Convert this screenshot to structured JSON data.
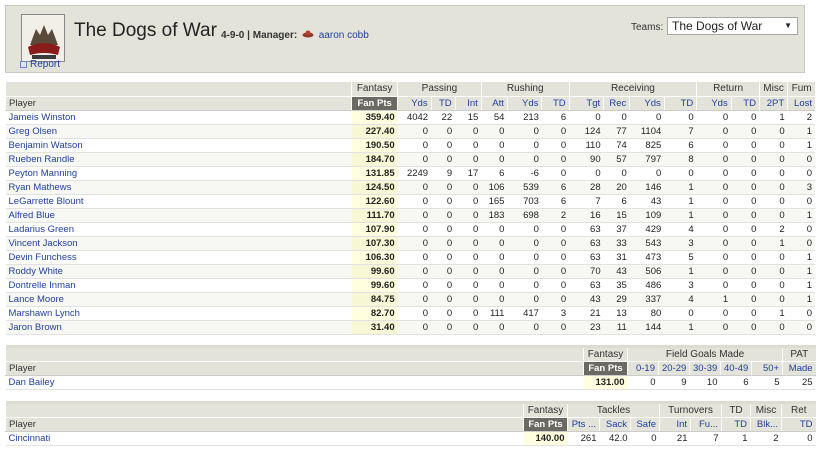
{
  "header": {
    "team_name": "The Dogs of War",
    "record": "4-9-0",
    "separator": "|",
    "manager_label": "Manager:",
    "manager_name": "aaron cobb",
    "report_link": "Report",
    "teams_label": "Teams:",
    "teams_selected": "The Dogs of War"
  },
  "offense": {
    "groups": [
      "Fantasy",
      "Passing",
      "Rushing",
      "Receiving",
      "Return",
      "Misc",
      "Fum"
    ],
    "columns": [
      "Player",
      "Fan Pts",
      "Yds",
      "TD",
      "Int",
      "Att",
      "Yds",
      "TD",
      "Tgt",
      "Rec",
      "Yds",
      "TD",
      "Yds",
      "TD",
      "2PT",
      "Lost"
    ],
    "rows": [
      [
        "Jameis Winston",
        "359.40",
        "4042",
        "22",
        "15",
        "54",
        "213",
        "6",
        "0",
        "0",
        "0",
        "0",
        "0",
        "0",
        "1",
        "2"
      ],
      [
        "Greg Olsen",
        "227.40",
        "0",
        "0",
        "0",
        "0",
        "0",
        "0",
        "124",
        "77",
        "1104",
        "7",
        "0",
        "0",
        "0",
        "1"
      ],
      [
        "Benjamin Watson",
        "190.50",
        "0",
        "0",
        "0",
        "0",
        "0",
        "0",
        "110",
        "74",
        "825",
        "6",
        "0",
        "0",
        "0",
        "1"
      ],
      [
        "Rueben Randle",
        "184.70",
        "0",
        "0",
        "0",
        "0",
        "0",
        "0",
        "90",
        "57",
        "797",
        "8",
        "0",
        "0",
        "0",
        "0"
      ],
      [
        "Peyton Manning",
        "131.85",
        "2249",
        "9",
        "17",
        "6",
        "-6",
        "0",
        "0",
        "0",
        "0",
        "0",
        "0",
        "0",
        "0",
        "0"
      ],
      [
        "Ryan Mathews",
        "124.50",
        "0",
        "0",
        "0",
        "106",
        "539",
        "6",
        "28",
        "20",
        "146",
        "1",
        "0",
        "0",
        "0",
        "3"
      ],
      [
        "LeGarrette Blount",
        "122.60",
        "0",
        "0",
        "0",
        "165",
        "703",
        "6",
        "7",
        "6",
        "43",
        "1",
        "0",
        "0",
        "0",
        "0"
      ],
      [
        "Alfred Blue",
        "111.70",
        "0",
        "0",
        "0",
        "183",
        "698",
        "2",
        "16",
        "15",
        "109",
        "1",
        "0",
        "0",
        "0",
        "1"
      ],
      [
        "Ladarius Green",
        "107.90",
        "0",
        "0",
        "0",
        "0",
        "0",
        "0",
        "63",
        "37",
        "429",
        "4",
        "0",
        "0",
        "2",
        "0"
      ],
      [
        "Vincent Jackson",
        "107.30",
        "0",
        "0",
        "0",
        "0",
        "0",
        "0",
        "63",
        "33",
        "543",
        "3",
        "0",
        "0",
        "1",
        "0"
      ],
      [
        "Devin Funchess",
        "106.30",
        "0",
        "0",
        "0",
        "0",
        "0",
        "0",
        "63",
        "31",
        "473",
        "5",
        "0",
        "0",
        "0",
        "1"
      ],
      [
        "Roddy White",
        "99.60",
        "0",
        "0",
        "0",
        "0",
        "0",
        "0",
        "70",
        "43",
        "506",
        "1",
        "0",
        "0",
        "0",
        "1"
      ],
      [
        "Dontrelle Inman",
        "99.60",
        "0",
        "0",
        "0",
        "0",
        "0",
        "0",
        "63",
        "35",
        "486",
        "3",
        "0",
        "0",
        "0",
        "1"
      ],
      [
        "Lance Moore",
        "84.75",
        "0",
        "0",
        "0",
        "0",
        "0",
        "0",
        "43",
        "29",
        "337",
        "4",
        "1",
        "0",
        "0",
        "1"
      ],
      [
        "Marshawn Lynch",
        "82.70",
        "0",
        "0",
        "0",
        "111",
        "417",
        "3",
        "21",
        "13",
        "80",
        "0",
        "0",
        "0",
        "1",
        "0"
      ],
      [
        "Jaron Brown",
        "31.40",
        "0",
        "0",
        "0",
        "0",
        "0",
        "0",
        "23",
        "11",
        "144",
        "1",
        "0",
        "0",
        "0",
        "0"
      ]
    ]
  },
  "kicker": {
    "groups": [
      "Fantasy",
      "Field Goals Made",
      "PAT"
    ],
    "columns": [
      "Player",
      "Fan Pts",
      "0-19",
      "20-29",
      "30-39",
      "40-49",
      "50+",
      "Made"
    ],
    "rows": [
      [
        "Dan Bailey",
        "131.00",
        "0",
        "9",
        "10",
        "6",
        "5",
        "25"
      ]
    ]
  },
  "defense": {
    "groups": [
      "Fantasy",
      "Tackles",
      "Turnovers",
      "TD",
      "Misc",
      "Ret"
    ],
    "columns": [
      "Player",
      "Fan Pts",
      "Pts ...",
      "Sack",
      "Safe",
      "Int",
      "Fu...",
      "TD",
      "Blk...",
      "TD"
    ],
    "rows": [
      [
        "Cincinnati",
        "140.00",
        "261",
        "42.0",
        "0",
        "21",
        "7",
        "1",
        "2",
        "0"
      ]
    ]
  }
}
